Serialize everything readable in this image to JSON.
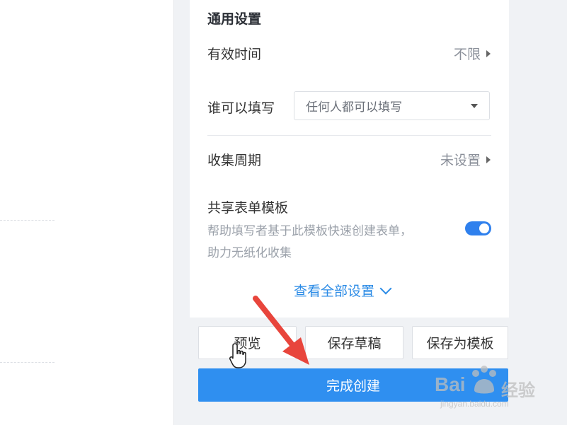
{
  "settings": {
    "section_title": "通用设置",
    "valid_time": {
      "label": "有效时间",
      "value": "不限"
    },
    "who_can_fill": {
      "label": "谁可以填写",
      "selected": "任何人都可以填写"
    },
    "collection_period": {
      "label": "收集周期",
      "value": "未设置"
    },
    "share_template": {
      "label": "共享表单模板",
      "description_line1": "帮助填写者基于此模板快速创建表单，",
      "description_line2": "助力无纸化收集",
      "enabled": true
    },
    "view_all": "查看全部设置"
  },
  "actions": {
    "preview": "预览",
    "save_draft": "保存草稿",
    "save_as_template": "保存为模板",
    "finish_create": "完成创建"
  },
  "watermark": {
    "brand_left": "Bai",
    "brand_right": "经验",
    "url": "jingyan.baidu.com"
  },
  "colors": {
    "accent": "#2f8ff0",
    "link": "#2b8be6",
    "arrow": "#e8453c",
    "panel_bg": "#f0f2f5"
  },
  "icons": [
    "triangle-right-icon",
    "caret-down-icon",
    "chevron-down-icon",
    "hand-cursor-icon",
    "red-arrow-annotation",
    "paw-icon"
  ]
}
